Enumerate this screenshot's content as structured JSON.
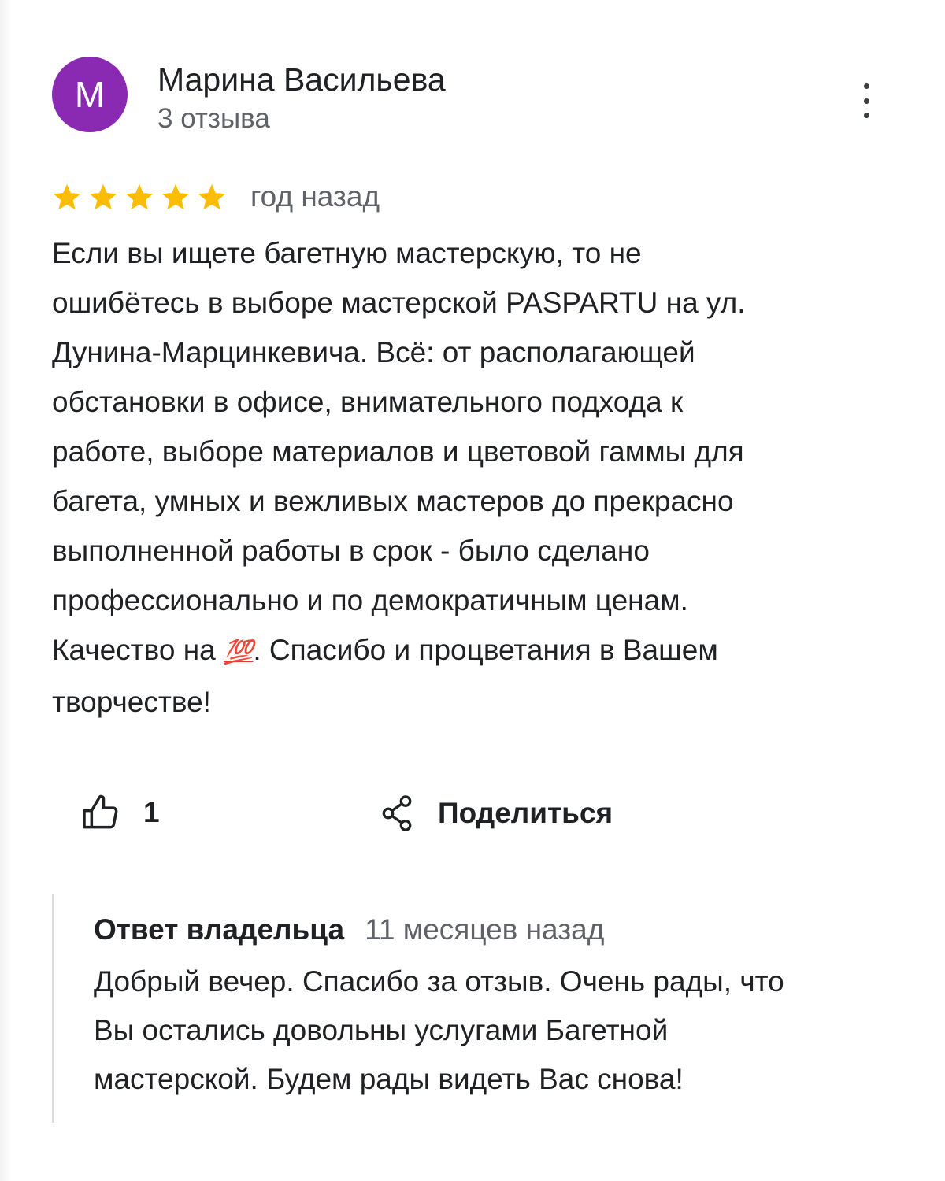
{
  "review": {
    "author": {
      "initial": "М",
      "avatar_color": "#8a2ab3",
      "name": "Марина Васильева",
      "review_count": "3 отзыва"
    },
    "menu_icon": "more-vertical-icon",
    "rating": 5,
    "rating_color": "#fbbc04",
    "date": "год назад",
    "text_before_emoji": "Если вы ищете багетную мастерскую, то не\nошибётесь в выборе  мастерской PASPARTU на ул.\nДунина-Марцинкевича. Всё: от располагающей\nобстановки в офисе, внимательного подхода к\nработе, выборе материалов и цветовой гаммы для\nбагета, умных и вежливых мастеров до прекрасно\nвыполненной работы в срок - было сделано\nпрофессионально и по демократичным ценам.\nКачество на ",
    "emoji": "💯",
    "text_after_emoji": ". Спасибо и процветания в Вашем\nтворчестве!"
  },
  "actions": {
    "like_icon": "thumbs-up-icon",
    "like_count": "1",
    "share_icon": "share-icon",
    "share_label": "Поделиться"
  },
  "owner_reply": {
    "title": "Ответ владельца",
    "date": "11 месяцев назад",
    "text": "Добрый вечер. Спасибо за отзыв. Очень рады, что\nВы остались довольны услугами Багетной\nмастерской. Будем рады видеть Вас снова!"
  }
}
